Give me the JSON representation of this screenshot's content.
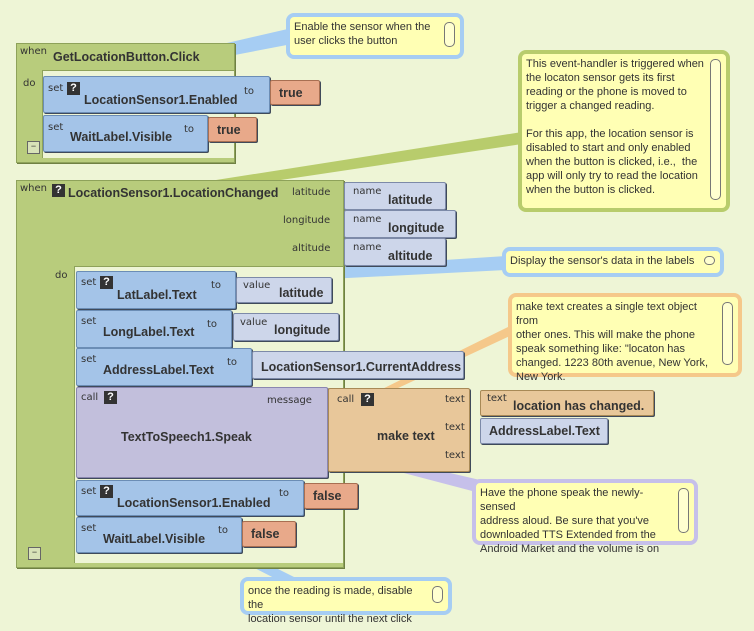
{
  "event1": {
    "when": "when",
    "do": "do",
    "title": "GetLocationButton.Click",
    "blocks": [
      {
        "kw": "set",
        "name": "LocationSensor1.Enabled",
        "to": "to",
        "value": "true"
      },
      {
        "kw": "set",
        "name": "WaitLabel.Visible",
        "to": "to",
        "value": "true"
      }
    ]
  },
  "event2": {
    "when": "when",
    "do": "do",
    "title": "LocationSensor1.LocationChanged",
    "params": [
      {
        "label": "latitude",
        "kw": "name",
        "value": "latitude"
      },
      {
        "label": "longitude",
        "kw": "name",
        "value": "longitude"
      },
      {
        "label": "altitude",
        "kw": "name",
        "value": "altitude"
      }
    ],
    "sets": [
      {
        "kw": "set",
        "name": "LatLabel.Text",
        "to": "to",
        "vkw": "value",
        "value": "latitude"
      },
      {
        "kw": "set",
        "name": "LongLabel.Text",
        "to": "to",
        "vkw": "value",
        "value": "longitude"
      },
      {
        "kw": "set",
        "name": "AddressLabel.Text",
        "to": "to",
        "value": "LocationSensor1.CurrentAddress"
      }
    ],
    "call": {
      "kw": "call",
      "name": "TextToSpeech1.Speak",
      "message": "message",
      "make": {
        "kw": "call",
        "name": "make text",
        "slots": [
          "text",
          "text",
          "text"
        ],
        "text_kw": "text",
        "text_value": "location has changed.",
        "address": "AddressLabel.Text"
      }
    },
    "after": [
      {
        "kw": "set",
        "name": "LocationSensor1.Enabled",
        "to": "to",
        "value": "false"
      },
      {
        "kw": "set",
        "name": "WaitLabel.Visible",
        "to": "to",
        "value": "false"
      }
    ]
  },
  "comments": {
    "enable": "Enable the sensor when the\nuser clicks the button",
    "handler": "This event-handler is triggered when\nthe locaton sensor gets its first\nreading or the phone is moved to\ntrigger a changed reading.\n\nFor this app, the location sensor is\ndisabled to start and only enabled\nwhen the button is clicked, i.e.,  the\napp will only try to read the location\nwhen the button is clicked.",
    "display": "Display the sensor's data in the labels",
    "maketext": "make text creates a single text object from\nother ones. This will make the phone\nspeak something like: \"locaton has\nchanged. 1223 80th avenue, New York,\nNew York.",
    "speak": "Have the phone speak the newly-sensed\naddress aloud. Be sure that you've\ndownloaded TTS Extended from the\nAndroid Market and the volume is on",
    "disable": "once the reading is made, disable the\nlocation sensor until the next click"
  },
  "icons": {
    "question": "?",
    "collapse": "−"
  },
  "colors": {
    "background": "#eef5d6",
    "event": "#b8cc7c",
    "setter": "#a4c4e8",
    "call": "#c2bfdc",
    "text": "#e8c79a",
    "boolean": "#e8a98a",
    "comment": "#ffffb4"
  }
}
